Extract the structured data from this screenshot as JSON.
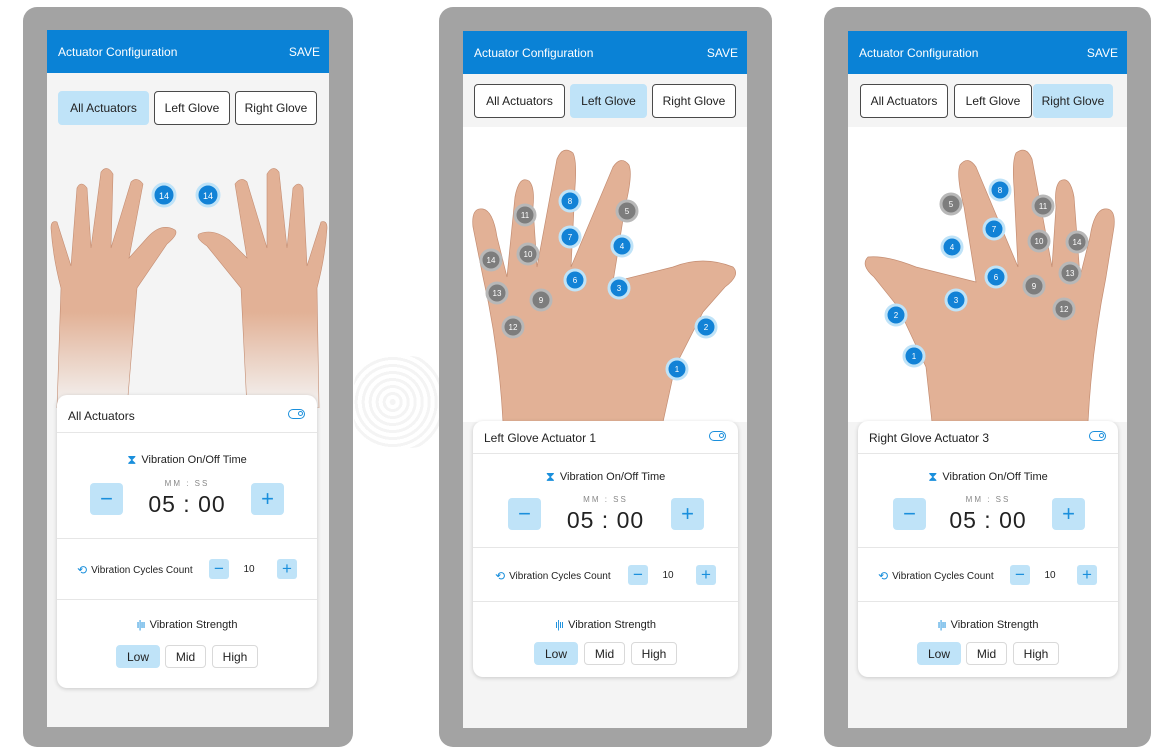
{
  "app": {
    "title": "Actuator Configuration",
    "save_label": "SAVE"
  },
  "tabs": [
    "All Actuators",
    "Left Glove",
    "Right Glove"
  ],
  "screens": [
    {
      "active_tab": 0,
      "card_title": "All Actuators",
      "vibration_time": {
        "label": "Vibration On/Off Time",
        "unit_hint": "MM  :  SS",
        "value": "05 : 00",
        "minus": "−",
        "plus": "+"
      },
      "cycles": {
        "label": "Vibration Cycles Count",
        "value": "10",
        "minus": "−",
        "plus": "+"
      },
      "strength": {
        "label": "Vibration Strength",
        "options": [
          "Low",
          "Mid",
          "High"
        ],
        "selected": "Low"
      },
      "actuator_markers": [
        "14",
        "14"
      ]
    },
    {
      "active_tab": 1,
      "card_title": "Left Glove Actuator 1",
      "vibration_time": {
        "label": "Vibration On/Off Time",
        "unit_hint": "MM  :  SS",
        "value": "05 : 00",
        "minus": "−",
        "plus": "+"
      },
      "cycles": {
        "label": "Vibration Cycles Count",
        "value": "10",
        "minus": "−",
        "plus": "+"
      },
      "strength": {
        "label": "Vibration Strength",
        "options": [
          "Low",
          "Mid",
          "High"
        ],
        "selected": "Low"
      },
      "actuator_markers": [
        "1",
        "2",
        "3",
        "4",
        "5",
        "6",
        "7",
        "8",
        "9",
        "10",
        "11",
        "12",
        "13",
        "14"
      ]
    },
    {
      "active_tab": 2,
      "card_title": "Right Glove Actuator 3",
      "vibration_time": {
        "label": "Vibration On/Off Time",
        "unit_hint": "MM  :  SS",
        "value": "05 : 00",
        "minus": "−",
        "plus": "+"
      },
      "cycles": {
        "label": "Vibration Cycles Count",
        "value": "10",
        "minus": "−",
        "plus": "+"
      },
      "strength": {
        "label": "Vibration Strength",
        "options": [
          "Low",
          "Mid",
          "High"
        ],
        "selected": "Low"
      },
      "actuator_markers": [
        "1",
        "2",
        "3",
        "4",
        "5",
        "6",
        "7",
        "8",
        "9",
        "10",
        "11",
        "12",
        "13",
        "14"
      ]
    }
  ],
  "colors": {
    "accent": "#0a82d6",
    "active_marker": "#1282d6",
    "inactive_marker": "#7d7d7d",
    "chip": "#bfe3f8",
    "frame": "#a3a3a3",
    "skin": "#e2b196"
  }
}
